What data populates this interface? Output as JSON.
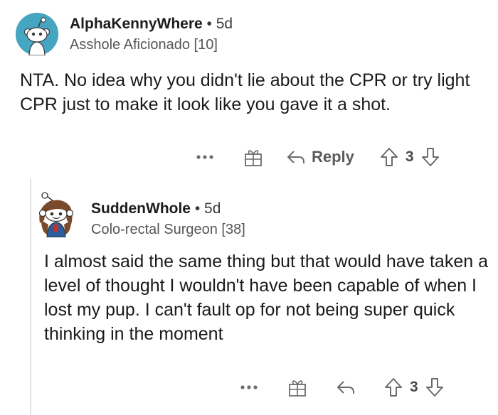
{
  "comments": [
    {
      "username": "AlphaKennyWhere",
      "separator": "•",
      "age": "5d",
      "flair": "Asshole Aficionado [10]",
      "body": "NTA. No idea why you didn't lie about the CPR or try light CPR just to make it look like you gave it a shot.",
      "actions": {
        "more": "more-icon",
        "award": "award-icon",
        "reply_label": "Reply",
        "score": "3"
      },
      "colors": {
        "avatar_bg": "#46a5c0"
      }
    },
    {
      "username": "SuddenWhole",
      "separator": "•",
      "age": "5d",
      "flair": "Colo-rectal Surgeon [38]",
      "body": "I almost said the same thing but that would have taken a level of thought I wouldn't have been capable of when I lost my pup. I can't fault op for not being super quick thinking in the moment",
      "actions": {
        "more": "more-icon",
        "award": "award-icon",
        "score": "3"
      },
      "colors": {
        "avatar_bg": "#ffffff"
      }
    }
  ]
}
